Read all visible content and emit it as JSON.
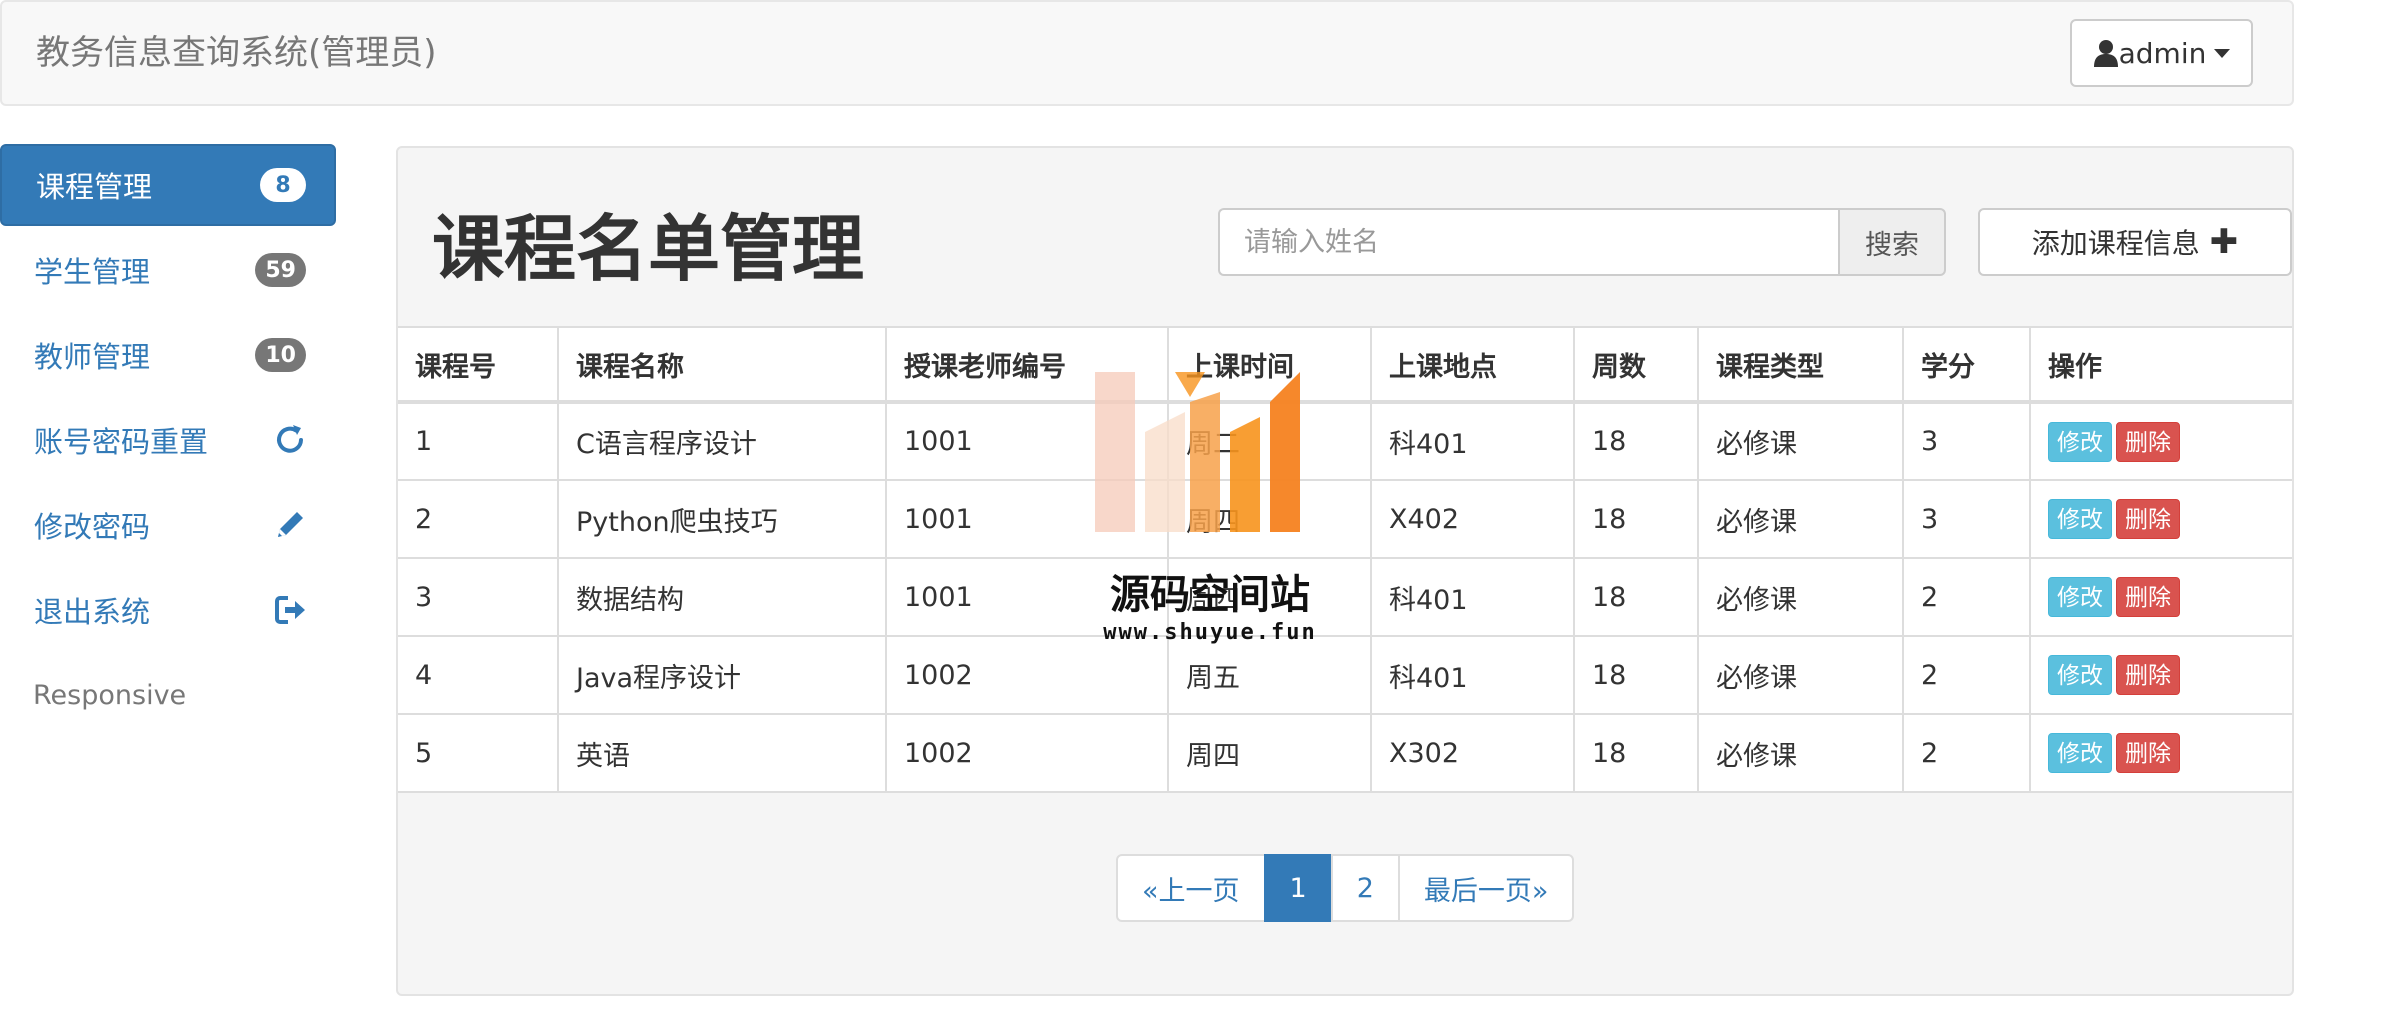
{
  "navbar": {
    "brand": "教务信息查询系统(管理员)",
    "user_label": "admin",
    "user_icon": "user-icon"
  },
  "sidebar": {
    "items": [
      {
        "label": "课程管理",
        "badge": "8",
        "active": true
      },
      {
        "label": "学生管理",
        "badge": "59"
      },
      {
        "label": "教师管理",
        "badge": "10"
      },
      {
        "label": "账号密码重置",
        "icon": "refresh-icon"
      },
      {
        "label": "修改密码",
        "icon": "pencil-icon"
      },
      {
        "label": "退出系统",
        "icon": "logout-icon"
      }
    ],
    "footer_text": "Responsive"
  },
  "main": {
    "title": "课程名单管理",
    "search": {
      "placeholder": "请输入姓名",
      "button_label": "搜索"
    },
    "add_button_label": "添加课程信息",
    "table": {
      "headers": [
        "课程号",
        "课程名称",
        "授课老师编号",
        "上课时间",
        "上课地点",
        "周数",
        "课程类型",
        "学分",
        "操作"
      ],
      "rows": [
        [
          "1",
          "C语言程序设计",
          "1001",
          "周二",
          "科401",
          "18",
          "必修课",
          "3"
        ],
        [
          "2",
          "Python爬虫技巧",
          "1001",
          "周四",
          "X402",
          "18",
          "必修课",
          "3"
        ],
        [
          "3",
          "数据结构",
          "1001",
          "周四",
          "科401",
          "18",
          "必修课",
          "2"
        ],
        [
          "4",
          "Java程序设计",
          "1002",
          "周五",
          "科401",
          "18",
          "必修课",
          "2"
        ],
        [
          "5",
          "英语",
          "1002",
          "周四",
          "X302",
          "18",
          "必修课",
          "2"
        ]
      ],
      "edit_label": "修改",
      "delete_label": "删除"
    },
    "pagination": {
      "prev": "«上一页",
      "pages": [
        "1",
        "2"
      ],
      "active_page": "1",
      "last": "最后一页»"
    }
  },
  "watermark": {
    "text": "源码空间站",
    "url": "www.shuyue.fun"
  },
  "colors": {
    "primary": "#337ab7",
    "info": "#5bc0de",
    "danger": "#d9534f",
    "badge": "#777777",
    "watermark_orange": "#f7941d"
  }
}
